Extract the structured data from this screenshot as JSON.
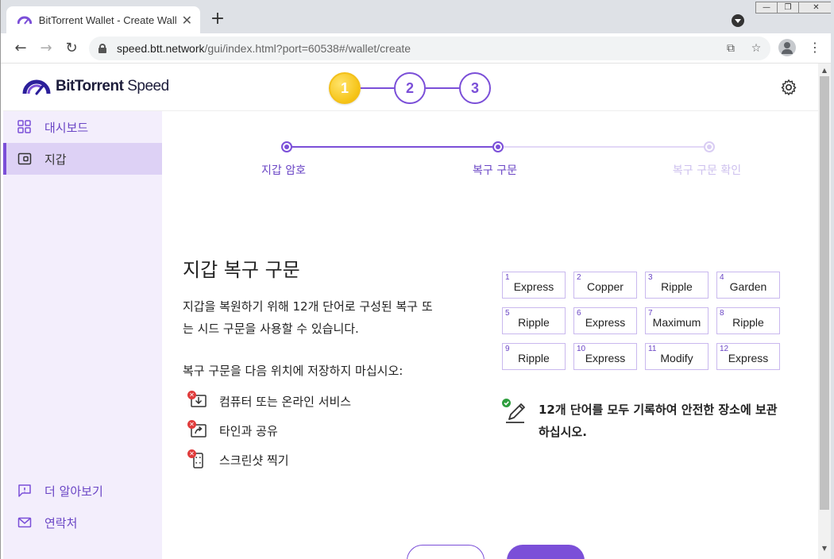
{
  "browser": {
    "tab_title": "BitTorrent Wallet - Create Wallet",
    "tab_close": "✕",
    "new_tab": "+",
    "url_host": "speed.btt.network",
    "url_path": "/gui/index.html?port=60538#/wallet/create",
    "window_controls": {
      "minimize": "—",
      "restore": "❐",
      "close": "✕"
    }
  },
  "app": {
    "logo_bold": "BitTorrent",
    "logo_light": " Speed",
    "brand_color": "#7b4fd8",
    "accent_gold": "#f6c417"
  },
  "stepper": [
    "1",
    "2",
    "3"
  ],
  "sidebar": {
    "items": [
      {
        "label": "대시보드",
        "icon": "dashboard-grid-icon"
      },
      {
        "label": "지갑",
        "icon": "wallet-icon"
      }
    ],
    "bottom": [
      {
        "label": "더 알아보기",
        "icon": "info-chat-icon"
      },
      {
        "label": "연락처",
        "icon": "mail-icon"
      }
    ]
  },
  "progress": {
    "steps": [
      {
        "label": "지갑 암호",
        "state": "done"
      },
      {
        "label": "복구 구문",
        "state": "current"
      },
      {
        "label": "복구 구문 확인",
        "state": "pending"
      }
    ]
  },
  "content": {
    "title": "지갑 복구 구문",
    "desc_line1": "지갑을 복원하기 위해 12개 단어로 구성된 복구 또",
    "desc_line2": "는 시드 구문을 사용할 수 있습니다.",
    "warn_title": "복구 구문을 다음 위치에 저장하지 마십시오:",
    "warnings": [
      {
        "label": "컴퓨터 또는 온라인 서비스",
        "icon": "download-screen-icon"
      },
      {
        "label": "타인과 공유",
        "icon": "share-icon"
      },
      {
        "label": "스크린샷 찍기",
        "icon": "screenshot-phone-icon"
      }
    ],
    "words": [
      {
        "n": "1",
        "w": "Express"
      },
      {
        "n": "2",
        "w": "Copper"
      },
      {
        "n": "3",
        "w": "Ripple"
      },
      {
        "n": "4",
        "w": "Garden"
      },
      {
        "n": "5",
        "w": "Ripple"
      },
      {
        "n": "6",
        "w": "Express"
      },
      {
        "n": "7",
        "w": "Maximum"
      },
      {
        "n": "8",
        "w": "Ripple"
      },
      {
        "n": "9",
        "w": "Ripple"
      },
      {
        "n": "10",
        "w": "Express"
      },
      {
        "n": "11",
        "w": "Modify"
      },
      {
        "n": "12",
        "w": "Express"
      }
    ],
    "note_line1": "12개 단어를 모두 기록하여 안전한 장소에 보관",
    "note_line2": "하십시오."
  }
}
